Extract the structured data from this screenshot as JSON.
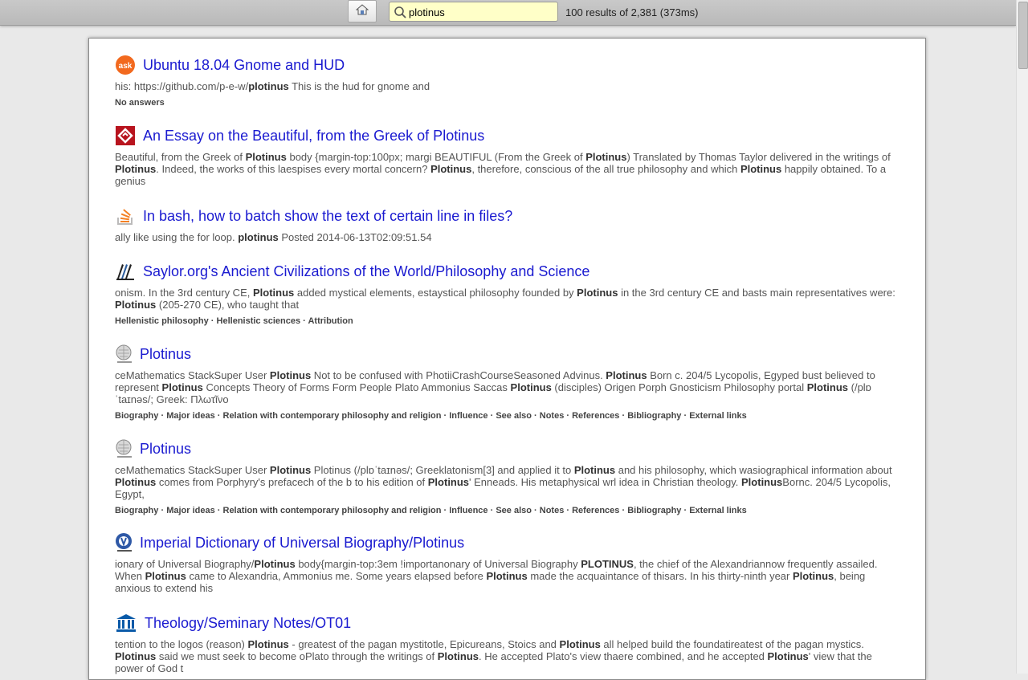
{
  "toolbar": {
    "search_value": "plotinus",
    "results_info": "100 results of 2,381 (373ms)"
  },
  "results": [
    {
      "title": "Ubuntu 18.04 Gnome and HUD",
      "icon": "askubuntu-icon",
      "snippet": [
        {
          "t": "his: https://github.com/p-e-w/"
        },
        {
          "b": "plotinus"
        },
        {
          "t": " This is the hud for gnome and"
        }
      ],
      "meta": [
        "No answers"
      ]
    },
    {
      "title": "An Essay on the Beautiful, from the Greek of Plotinus",
      "icon": "gutenberg-icon",
      "snippet": [
        {
          "t": "Beautiful, from the Greek of "
        },
        {
          "b": "Plotinus"
        },
        {
          "t": " body {margin-top:100px; margi BEAUTIFUL (From the Greek of "
        },
        {
          "b": "Plotinus"
        },
        {
          "t": ") Translated by Thomas Taylor delivered in the writings of "
        },
        {
          "b": "Plotinus"
        },
        {
          "t": ". Indeed, the works of this laespises every mortal concern? "
        },
        {
          "b": "Plotinus"
        },
        {
          "t": ", therefore, conscious of the all true philosophy and which "
        },
        {
          "b": "Plotinus"
        },
        {
          "t": " happily obtained. To a genius"
        }
      ],
      "meta": []
    },
    {
      "title": "In bash, how to batch show the text of certain line in files?",
      "icon": "stackoverflow-icon",
      "snippet": [
        {
          "t": "ally like using the for loop. "
        },
        {
          "b": "plotinus"
        },
        {
          "t": " Posted 2014-06-13T02:09:51.54"
        }
      ],
      "meta": []
    },
    {
      "title": "Saylor.org's Ancient Civilizations of the World/Philosophy and Science",
      "icon": "wikibooks-icon",
      "snippet": [
        {
          "t": "onism. In the 3rd century CE, "
        },
        {
          "b": "Plotinus"
        },
        {
          "t": " added mystical elements, estaystical philosophy founded by "
        },
        {
          "b": "Plotinus"
        },
        {
          "t": " in the 3rd century CE and basts main representatives were: "
        },
        {
          "b": "Plotinus"
        },
        {
          "t": " (205-270 CE), who taught that"
        }
      ],
      "meta": [
        "Hellenistic philosophy",
        "Hellenistic sciences",
        "Attribution"
      ]
    },
    {
      "title": "Plotinus",
      "icon": "wikipedia-icon",
      "snippet": [
        {
          "t": "ceMathematics StackSuper User "
        },
        {
          "b": "Plotinus"
        },
        {
          "t": " Not to be confused with PhotiiCrashCourseSeasoned Advinus. "
        },
        {
          "b": "Plotinus"
        },
        {
          "t": " Born c. 204/5 Lycopolis, Egyped bust believed to represent "
        },
        {
          "b": "Plotinus"
        },
        {
          "t": " Concepts Theory of Forms Form People Plato Ammonius Saccas "
        },
        {
          "b": "Plotinus"
        },
        {
          "t": " (disciples) Origen Porph Gnosticism Philosophy portal "
        },
        {
          "b": "Plotinus"
        },
        {
          "t": " (/plɒˈtaɪnəs/; Greek: Πλωτῖνο"
        }
      ],
      "meta": [
        "Biography",
        "Major ideas",
        "Relation with contemporary philosophy and religion",
        "Influence",
        "See also",
        "Notes",
        "References",
        "Bibliography",
        "External links"
      ]
    },
    {
      "title": "Plotinus",
      "icon": "wikipedia-icon",
      "snippet": [
        {
          "t": "ceMathematics StackSuper User "
        },
        {
          "b": "Plotinus"
        },
        {
          "t": " Plotinus (/plɒˈtaɪnəs/; Greeklatonism[3] and applied it to "
        },
        {
          "b": "Plotinus"
        },
        {
          "t": " and his philosophy, which wasiographical information about "
        },
        {
          "b": "Plotinus"
        },
        {
          "t": " comes from Porphyry's prefacech of the b to his edition of "
        },
        {
          "b": "Plotinus"
        },
        {
          "t": "' Enneads. His metaphysical wrl idea in Christian theology. "
        },
        {
          "b": "Plotinus"
        },
        {
          "t": "Bornc. 204/5 Lycopolis, Egypt,"
        }
      ],
      "meta": [
        "Biography",
        "Major ideas",
        "Relation with contemporary philosophy and religion",
        "Influence",
        "See also",
        "Notes",
        "References",
        "Bibliography",
        "External links"
      ]
    },
    {
      "title": "Imperial Dictionary of Universal Biography/Plotinus",
      "icon": "wikisource-icon",
      "snippet": [
        {
          "t": "ionary of Universal Biography/"
        },
        {
          "b": "Plotinus"
        },
        {
          "t": " body{margin-top:3em !importanonary of Universal Biography "
        },
        {
          "b": "PLOTINUS"
        },
        {
          "t": ", the chief of the Alexandriannow frequently assailed. When "
        },
        {
          "b": "Plotinus"
        },
        {
          "t": " came to Alexandria, Ammonius me. Some years elapsed before "
        },
        {
          "b": "Plotinus"
        },
        {
          "t": " made the acquaintance of thisars. In his thirty-ninth year "
        },
        {
          "b": "Plotinus"
        },
        {
          "t": ", being anxious to extend his"
        }
      ],
      "meta": []
    },
    {
      "title": "Theology/Seminary Notes/OT01",
      "icon": "wikiversity-icon",
      "snippet": [
        {
          "t": "tention to the logos (reason) "
        },
        {
          "b": "Plotinus"
        },
        {
          "t": " - greatest of the pagan mystitotle, Epicureans, Stoics and "
        },
        {
          "b": "Plotinus"
        },
        {
          "t": " all helped build the foundatireatest of the pagan mystics. "
        },
        {
          "b": "Plotinus"
        },
        {
          "t": " said we must seek to become oPlato through the writings of "
        },
        {
          "b": "Plotinus"
        },
        {
          "t": ". He accepted Plato's view thaere combined, and he accepted "
        },
        {
          "b": "Plotinus"
        },
        {
          "t": "' view that the power of God t"
        }
      ],
      "meta": []
    }
  ]
}
